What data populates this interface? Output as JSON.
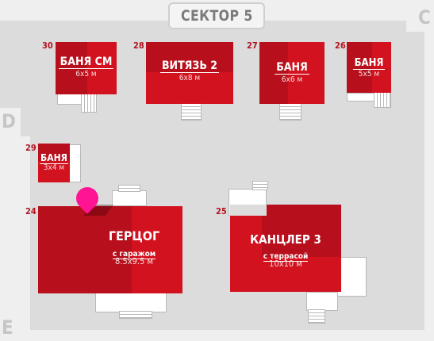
{
  "sector": {
    "label": "СЕКТОР 5"
  },
  "side_labels": {
    "c": "C",
    "d": "D",
    "e": "E"
  },
  "plots": [
    {
      "number": "30",
      "name": "БАНЯ СМ",
      "size": "6х5 м"
    },
    {
      "number": "28",
      "name": "ВИТЯЗЬ 2",
      "size": "6х8 м"
    },
    {
      "number": "27",
      "name": "БАНЯ",
      "size": "6х6 м"
    },
    {
      "number": "26",
      "name": "БАНЯ",
      "size": "5х5 м"
    },
    {
      "number": "29",
      "name": "БАНЯ",
      "size": "3х4 м"
    },
    {
      "number": "24",
      "name": "ГЕРЦОГ",
      "subtitle": "с гаражом",
      "size": "8.5х9.5 м"
    },
    {
      "number": "25",
      "name": "КАНЦЛЕР 3",
      "subtitle": "с террасой",
      "size": "10х10 м"
    }
  ],
  "colors": {
    "house_red": "#d3121f",
    "house_red_dark": "#b70f1b",
    "plot_number": "#b3121f",
    "ground": "#dcdcdc",
    "location_pin": "#ff1493"
  },
  "icons": {
    "selected_plot": "location-pin-icon"
  }
}
